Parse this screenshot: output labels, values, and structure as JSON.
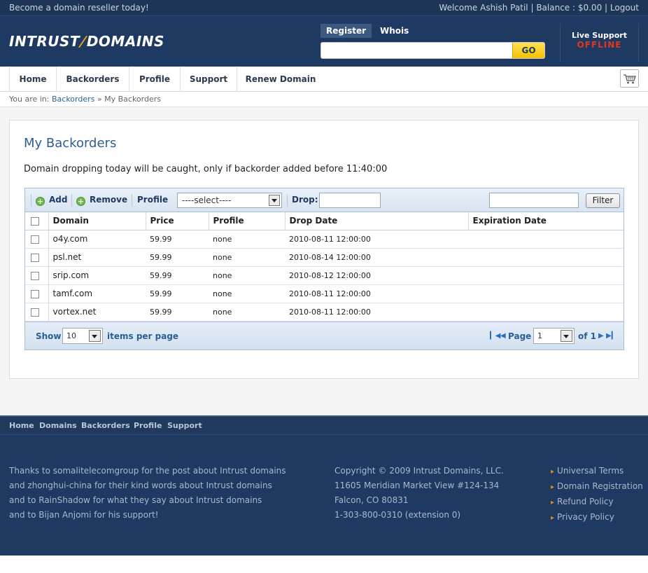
{
  "topbar": {
    "promo": "Become a domain reseller today!",
    "welcome": "Welcome Ashish Patil",
    "balance": "Balance : $0.00",
    "logout": "Logout",
    "separator": "|"
  },
  "header": {
    "logo_left": "INTRUST",
    "logo_right": "DOMAINS",
    "tabs": [
      "Register",
      "Whois"
    ],
    "search_placeholder": "",
    "go_label": "GO",
    "live_support": "Live Support",
    "live_status": "OFFLINE",
    "colors": {
      "header_bg": "#1f3a62",
      "accent": "#f2a21b",
      "go": "#f5c000",
      "offline": "#e0381c"
    }
  },
  "nav": {
    "items": [
      "Home",
      "Backorders",
      "Profile",
      "Support",
      "Renew Domain"
    ],
    "cart_icon": "shopping-cart-icon"
  },
  "breadcrumb": {
    "prefix": "You are in:",
    "link": "Backorders",
    "sep": "»",
    "current": "My Backorders"
  },
  "main": {
    "title": "My Backorders",
    "note": "Domain dropping today will be caught, only if backorder added before 11:40:00",
    "toolbar": {
      "add": "Add",
      "remove": "Remove",
      "profile": "Profile",
      "profile_select": "----select----",
      "drop": "Drop:",
      "drop_value": "",
      "filter_value": "",
      "filter": "Filter"
    },
    "columns": [
      "Domain",
      "Price",
      "Profile",
      "Drop Date",
      "Expiration Date"
    ],
    "rows": [
      {
        "domain": "o4y.com",
        "price": "59.99",
        "profile": "none",
        "drop": "2010-08-11 12:00:00",
        "expiration": ""
      },
      {
        "domain": "psl.net",
        "price": "59.99",
        "profile": "none",
        "drop": "2010-08-14 12:00:00",
        "expiration": ""
      },
      {
        "domain": "srip.com",
        "price": "59.99",
        "profile": "none",
        "drop": "2010-08-12 12:00:00",
        "expiration": ""
      },
      {
        "domain": "tamf.com",
        "price": "59.99",
        "profile": "none",
        "drop": "2010-08-11 12:00:00",
        "expiration": ""
      },
      {
        "domain": "vortex.net",
        "price": "59.99",
        "profile": "none",
        "drop": "2010-08-11 12:00:00",
        "expiration": ""
      }
    ],
    "pager": {
      "show": "Show",
      "per_page": "10",
      "items_per_page": "items per page",
      "page": "Page",
      "page_value": "1",
      "of": "of 1"
    }
  },
  "footer": {
    "links": [
      "Home",
      "Domains",
      "Backorders",
      "Profile",
      "Support"
    ],
    "thanks": [
      "Thanks to somalitelecomgroup for the post about Intrust domains",
      "and zhonghui-china for their kind words about Intrust domains",
      "and to RainShadow for what they say about Intrust domains",
      "and to Bijan Anjomi for his support!"
    ],
    "contact": [
      "Copyright © 2009 Intrust Domains, LLC.",
      "11605 Meridian Market View #124-134",
      "Falcon, CO 80831",
      "1-303-800-0310 (extension 0)"
    ],
    "policies": [
      "Universal Terms",
      "Domain Registration",
      "Refund Policy",
      "Privacy Policy"
    ]
  }
}
